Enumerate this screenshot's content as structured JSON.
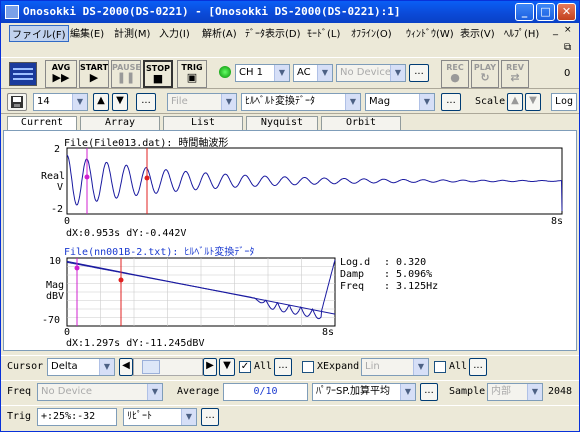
{
  "window": {
    "title": "Onosokki DS-2000(DS-0221) - [Onosokki DS-2000(DS-0221):1]",
    "minimize": "_",
    "maximize": "□",
    "close": "✕"
  },
  "menu": {
    "items": [
      "ファイル(F)",
      "編集(E)",
      "計測(M)",
      "入力(I)",
      "解析(A)",
      "ﾃﾞｰﾀ表示(D)",
      "ﾓｰﾄﾞ(L)",
      "ｵﾌﾗｲﾝ(O)",
      "ｳｨﾝﾄﾞｳ(W)",
      "表示(V)",
      "ﾍﾙﾌﾟ(H)"
    ],
    "mdi_min": "_",
    "mdi_restore": "⧉",
    "mdi_close": "×"
  },
  "toolbar1": {
    "avg": "AVG",
    "start": "START",
    "pause": "PAUSE",
    "stop": "STOP",
    "trig": "TRIG",
    "channel": "CH 1",
    "coupling": "AC",
    "device": "No Device",
    "rec": "REC",
    "play": "PLAY",
    "rev": "REV",
    "more": "...",
    "zero": "0"
  },
  "toolbar2": {
    "number": "14",
    "file": "File",
    "transform": "ﾋﾙﾍﾞﾙﾄ変換ﾃﾞｰﾀ",
    "mag": "Mag",
    "scale_label": "Scale",
    "log": "Log",
    "more": "..."
  },
  "tabs": [
    "Current",
    "Array",
    "List",
    "Nyquist",
    "Orbit"
  ],
  "plot1": {
    "title": "File(File013.dat): 時間軸波形",
    "ylabel": "Real",
    "yunit": "V",
    "ytop": "2",
    "ybottom": "-2",
    "xstart": "0",
    "xend": "8s",
    "readout": "dX:0.953s dY:-0.442V"
  },
  "plot2": {
    "title": "File(nn001B-2.txt): ﾋﾙﾍﾞﾙﾄ変換ﾃﾞｰﾀ",
    "ylabel": "Mag",
    "yunit": "dBV",
    "ytop": "10",
    "ybottom": "-70",
    "xstart": "0",
    "xend": "8s",
    "readout": "dX:1.297s dY:-11.245dBV",
    "stats": [
      {
        "k": "Log.d",
        "v": ": 0.320"
      },
      {
        "k": "Damp",
        "v": ": 5.096%"
      },
      {
        "k": "Freq",
        "v": ": 3.125Hz"
      }
    ]
  },
  "cursor_bar": {
    "label": "Cursor",
    "mode": "Delta",
    "all": "All",
    "xexpand": "XExpand",
    "lin": "Lin",
    "all2": "All",
    "more": "..."
  },
  "freq_bar": {
    "label": "Freq",
    "device": "No Device",
    "average_label": "Average",
    "average_value": "0/10",
    "avg_mode": "ﾊﾟﾜｰSP.加算平均",
    "sample_label": "Sample",
    "sample_src": "内部",
    "sample_count": "2048",
    "more": "..."
  },
  "trig_bar": {
    "label": "Trig",
    "value": "+:25%:-32",
    "mode": "ﾘﾋﾟｰﾄ",
    "more": "..."
  },
  "colors": {
    "titlebar": "#0a5ef5",
    "plot_line": "#1a1aa0",
    "cursor1": "#d020d0",
    "cursor2": "#e02020"
  }
}
